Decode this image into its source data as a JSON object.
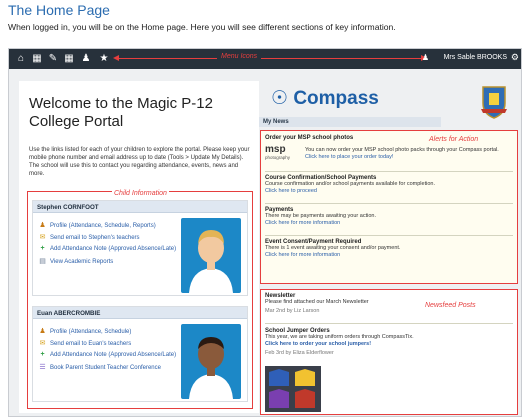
{
  "doc": {
    "title": "The Home Page",
    "subtitle": "When logged in, you will be on the Home page.  Here you will see different sections of key information."
  },
  "navbar": {
    "annotation": "Menu Icons",
    "user_name": "Mrs Sable BROOKS",
    "icons": [
      "home-icon",
      "calendar-icon",
      "edit-icon",
      "grid-icon",
      "people-icon",
      "star-icon"
    ]
  },
  "portal": {
    "welcome": "Welcome to the Magic P-12 College Portal",
    "intro": "Use the links listed for each of your children to explore the portal. Please keep your mobile phone number and email address up to date (Tools > Update My Details). The school will use this to contact you regarding attendance, events, news and more.",
    "annotation": "Child Information",
    "children": [
      {
        "name": "Stephen CORNFOOT",
        "links": [
          {
            "icon": "profile-icon",
            "label": "Profile (Attendance, Schedule, Reports)"
          },
          {
            "icon": "email-icon",
            "label": "Send email to Stephen's teachers"
          },
          {
            "icon": "plus-icon",
            "label": "Add Attendance Note (Approved Absence/Late)"
          },
          {
            "icon": "report-icon",
            "label": "View Academic Reports"
          }
        ]
      },
      {
        "name": "Euan ABERCROMBIE",
        "links": [
          {
            "icon": "profile-icon",
            "label": "Profile (Attendance, Schedule)"
          },
          {
            "icon": "email-icon",
            "label": "Send email to Euan's teachers"
          },
          {
            "icon": "plus-icon",
            "label": "Add Attendance Note (Approved Absence/Late)"
          },
          {
            "icon": "conference-icon",
            "label": "Book Parent Student Teacher Conference"
          }
        ]
      }
    ]
  },
  "compass": {
    "logo_text": "Compass",
    "my_news": "My News",
    "alerts_annotation": "Alerts for Action",
    "alerts": [
      {
        "title": "Order your MSP school photos",
        "body": "You can now order your MSP school photo packs through your Compass portal.",
        "link": "Click here to place your order today!",
        "logo": "msp",
        "logo_sub": "photography"
      },
      {
        "title": "Course Confirmation/School Payments",
        "body": "Course confirmation and/or school payments available for completion.",
        "link": "Click here to proceed"
      },
      {
        "title": "Payments",
        "body": "There may be payments awaiting your action.",
        "link": "Click here for more information"
      },
      {
        "title": "Event Consent/Payment Required",
        "body": "There is 1 event awaiting your consent and/or payment.",
        "link": "Click here for more information"
      }
    ],
    "news_annotation": "Newsfeed Posts",
    "news": [
      {
        "title": "Newsletter",
        "body": "Please find attached our March Newsletter",
        "meta": "Mar 2nd by Liz Larson"
      },
      {
        "title": "School Jumper Orders",
        "body": "This year, we are taking uniform orders through CompassTix.",
        "link": "Click here to order your school jumpers!",
        "meta": "Feb 3rd by Eliza Elderflower"
      }
    ]
  },
  "colors": {
    "navbar": "#27313b",
    "annotation_red": "#e53e3e",
    "link_blue": "#2a5ea8",
    "compass_blue": "#1e5fa6",
    "photo_bg": "#1c88c7"
  }
}
